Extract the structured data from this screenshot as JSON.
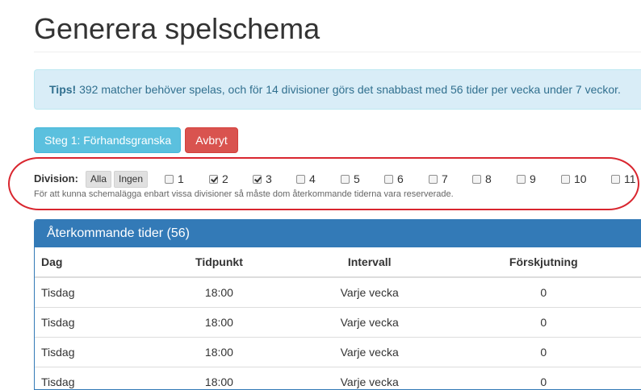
{
  "page": {
    "title": "Generera spelschema"
  },
  "alert": {
    "label": "Tips!",
    "text": " 392 matcher behöver spelas, och för 14 divisioner görs det snabbast med 56 tider per vecka under 7 veckor."
  },
  "buttons": {
    "preview": "Steg 1: Förhandsgranska",
    "cancel": "Avbryt"
  },
  "division": {
    "label": "Division:",
    "all": "Alla",
    "none": "Ingen",
    "options": [
      {
        "label": "1",
        "checked": false
      },
      {
        "label": "2",
        "checked": true
      },
      {
        "label": "3",
        "checked": true
      },
      {
        "label": "4",
        "checked": false
      },
      {
        "label": "5",
        "checked": false
      },
      {
        "label": "6",
        "checked": false
      },
      {
        "label": "7",
        "checked": false
      },
      {
        "label": "8",
        "checked": false
      },
      {
        "label": "9",
        "checked": false
      },
      {
        "label": "10",
        "checked": false
      },
      {
        "label": "11",
        "checked": false
      }
    ],
    "help": "För att kunna schemalägga enbart vissa divisioner så måste dom återkommande tiderna vara reserverade."
  },
  "recurring": {
    "title": "Återkommande tider (56)",
    "columns": [
      "Dag",
      "Tidpunkt",
      "Intervall",
      "Förskjutning"
    ],
    "rows": [
      [
        "Tisdag",
        "18:00",
        "Varje vecka",
        "0"
      ],
      [
        "Tisdag",
        "18:00",
        "Varje vecka",
        "0"
      ],
      [
        "Tisdag",
        "18:00",
        "Varje vecka",
        "0"
      ],
      [
        "Tisdag",
        "18:00",
        "Varje vecka",
        "0"
      ]
    ]
  },
  "colors": {
    "info_bg": "#d9edf7",
    "info_text": "#31708f",
    "btn_info": "#5bc0de",
    "btn_danger": "#d9534f",
    "panel_primary": "#337ab7",
    "highlight": "#d9262f"
  }
}
